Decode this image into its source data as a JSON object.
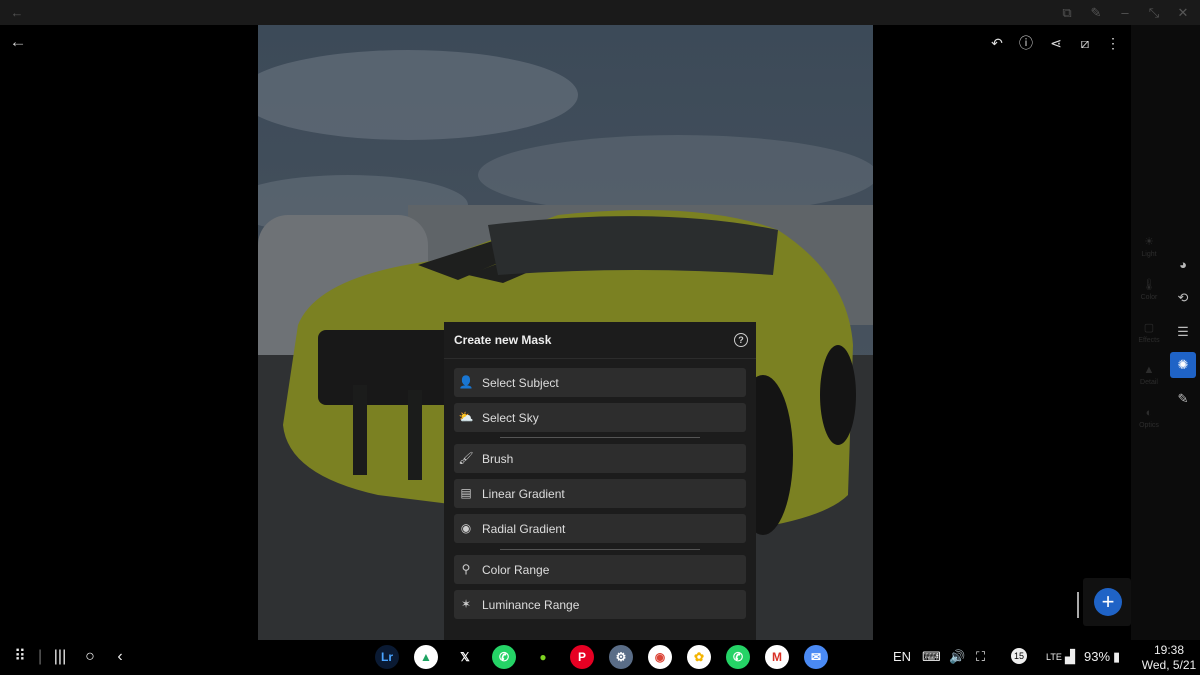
{
  "dialog": {
    "title": "Create new Mask",
    "options_group1": [
      {
        "label": "Select Subject",
        "icon": "person-icon"
      },
      {
        "label": "Select Sky",
        "icon": "sky-icon"
      }
    ],
    "options_group2": [
      {
        "label": "Brush",
        "icon": "brush-icon"
      },
      {
        "label": "Linear Gradient",
        "icon": "linear-gradient-icon"
      },
      {
        "label": "Radial Gradient",
        "icon": "radial-gradient-icon"
      }
    ],
    "options_group3": [
      {
        "label": "Color Range",
        "icon": "color-range-icon"
      },
      {
        "label": "Luminance Range",
        "icon": "luminance-range-icon"
      }
    ]
  },
  "side_panel": {
    "items": [
      "Light",
      "Color",
      "Effects",
      "Detail",
      "Optics"
    ]
  },
  "taskbar": {
    "apps": [
      {
        "name": "Lightroom",
        "text": "Lr",
        "bg": "#0a1a33",
        "fg": "#4aa4ff"
      },
      {
        "name": "Google Drive",
        "text": "▲",
        "bg": "#ffffff",
        "fg": "#1ea362"
      },
      {
        "name": "X",
        "text": "𝕏",
        "bg": "#000000",
        "fg": "#ffffff"
      },
      {
        "name": "WhatsApp",
        "text": "✆",
        "bg": "#25d366",
        "fg": "#ffffff"
      },
      {
        "name": "Green app",
        "text": "●",
        "bg": "#000000",
        "fg": "#7ed321"
      },
      {
        "name": "Pinterest",
        "text": "P",
        "bg": "#e60023",
        "fg": "#ffffff"
      },
      {
        "name": "Settings",
        "text": "⚙",
        "bg": "#5a6d87",
        "fg": "#ffffff"
      },
      {
        "name": "Chrome",
        "text": "◉",
        "bg": "#ffffff",
        "fg": "#db4437"
      },
      {
        "name": "Google Photos",
        "text": "✿",
        "bg": "#ffffff",
        "fg": "#f4b400"
      },
      {
        "name": "WhatsApp Business",
        "text": "✆",
        "bg": "#25d366",
        "fg": "#ffffff"
      },
      {
        "name": "Gmail",
        "text": "M",
        "bg": "#ffffff",
        "fg": "#d93025"
      },
      {
        "name": "Messages",
        "text": "✉",
        "bg": "#4a8af4",
        "fg": "#ffffff"
      }
    ],
    "lang": "EN",
    "notification_count": "15",
    "network": "LTE",
    "battery": "93%",
    "time": "19:38",
    "date": "Wed, 5/21"
  },
  "colors": {
    "accent": "#1f63c6",
    "dialog_bg": "#1c1c1c",
    "option_bg": "#2d2d2d"
  }
}
